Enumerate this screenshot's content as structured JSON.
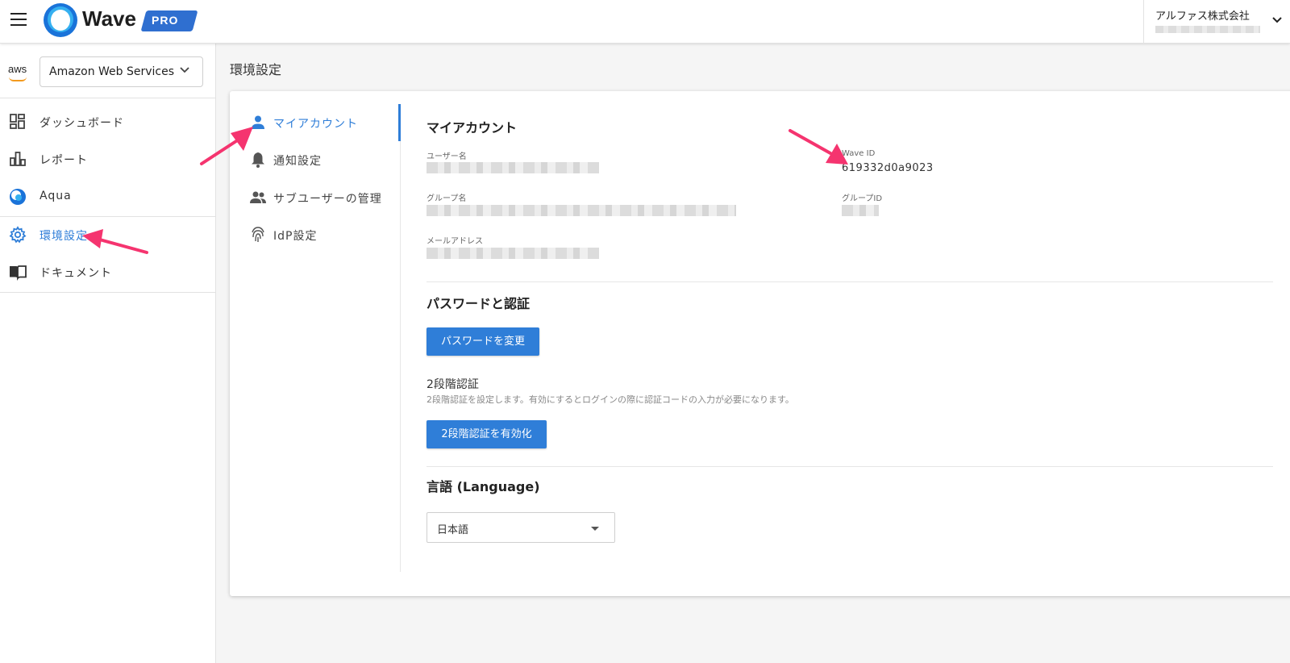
{
  "header": {
    "logo_text": "Wave",
    "badge": "PRO",
    "account_name": "アルファス株式会社",
    "icons": {
      "menu": "hamburger-icon",
      "logo": "wave-logo-icon",
      "account_toggle": "chevron-down-icon"
    }
  },
  "sidebar": {
    "provider_logo": "aws",
    "provider_selected": "Amazon Web Services",
    "items": [
      {
        "label": "ダッシュボード",
        "icon": "dashboard-icon"
      },
      {
        "label": "レポート",
        "icon": "bar-chart-icon"
      },
      {
        "label": "Aqua",
        "icon": "aqua-icon"
      },
      {
        "label": "環境設定",
        "icon": "gear-icon",
        "active": true
      },
      {
        "label": "ドキュメント",
        "icon": "book-icon"
      }
    ]
  },
  "page": {
    "title": "環境設定"
  },
  "sub_nav": {
    "items": [
      {
        "label": "マイアカウント",
        "icon": "person-icon",
        "active": true
      },
      {
        "label": "通知設定",
        "icon": "bell-icon"
      },
      {
        "label": "サブユーザーの管理",
        "icon": "people-icon"
      },
      {
        "label": "IdP設定",
        "icon": "fingerprint-icon"
      }
    ]
  },
  "my_account": {
    "title": "マイアカウント",
    "username_label": "ユーザー名",
    "wave_id_label": "Wave ID",
    "wave_id_value": "619332d0a9023",
    "group_name_label": "グループ名",
    "group_id_label": "グループID",
    "email_label": "メールアドレス"
  },
  "password": {
    "title": "パスワードと認証",
    "change_button": "パスワードを変更",
    "twofa_title": "2段階認証",
    "twofa_desc": "2段階認証を設定します。有効にするとログインの際に認証コードの入力が必要になります。",
    "twofa_button": "2段階認証を有効化"
  },
  "language": {
    "title": "言語 (Language)",
    "selected": "日本語"
  },
  "colors": {
    "accent": "#2f7ed8",
    "annotation_arrow": "#f5346f",
    "aws_orange": "#f39a1e"
  }
}
